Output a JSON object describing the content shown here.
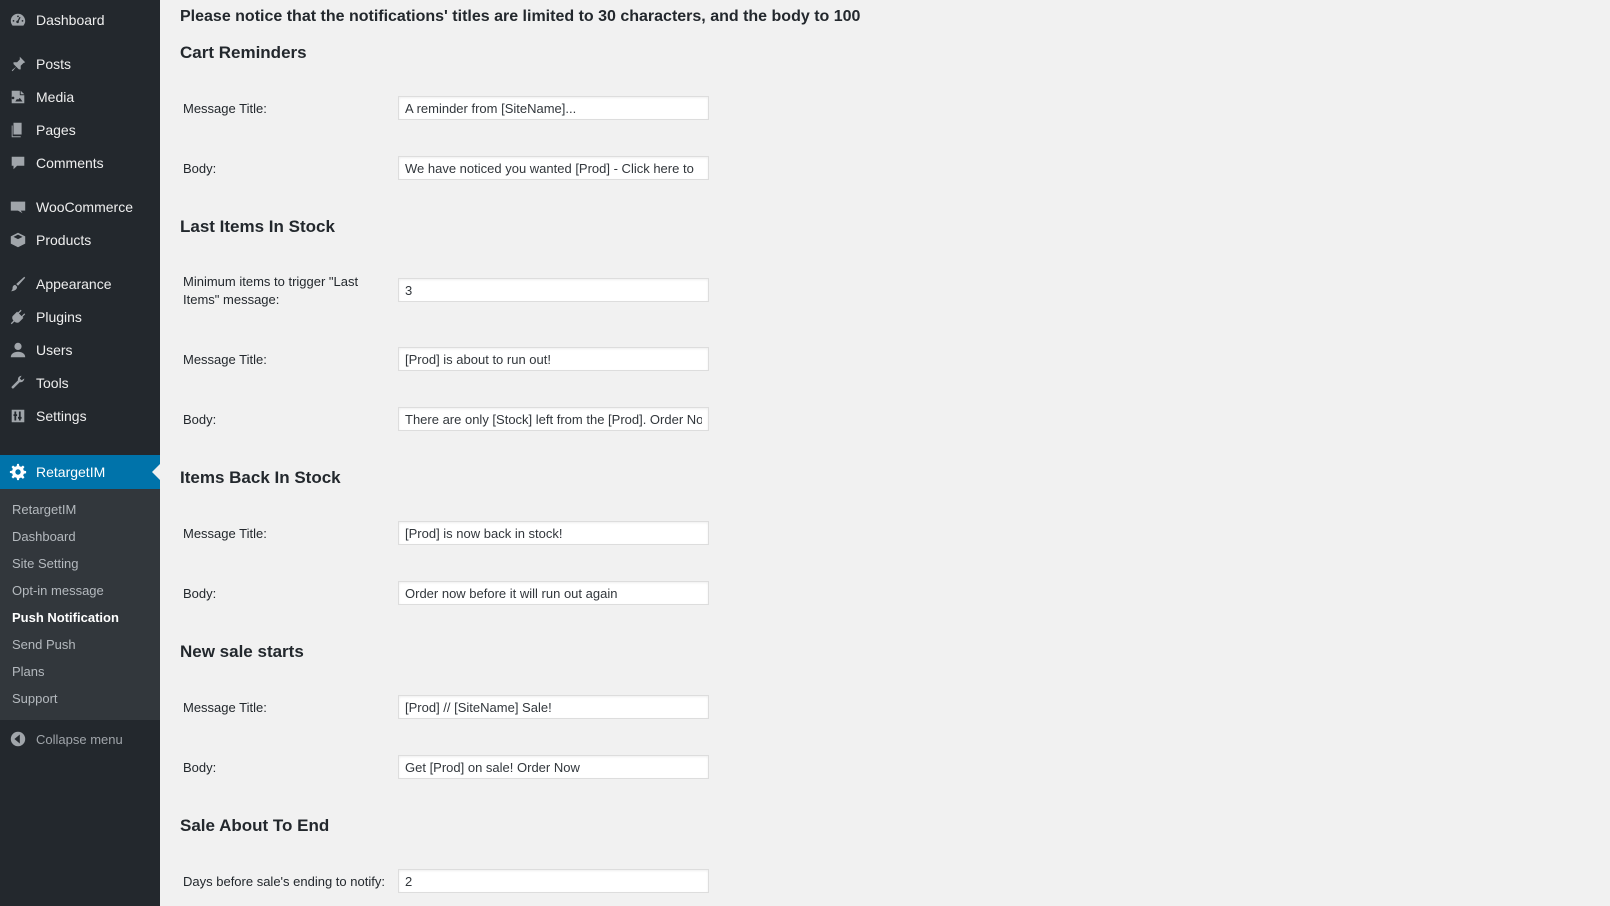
{
  "sidebar": {
    "items": [
      {
        "label": "Dashboard",
        "icon": "dashboard-icon"
      },
      {
        "label": "Posts",
        "icon": "pin-icon"
      },
      {
        "label": "Media",
        "icon": "media-icon"
      },
      {
        "label": "Pages",
        "icon": "pages-icon"
      },
      {
        "label": "Comments",
        "icon": "comment-icon"
      },
      {
        "label": "WooCommerce",
        "icon": "woocommerce-icon"
      },
      {
        "label": "Products",
        "icon": "box-icon"
      },
      {
        "label": "Appearance",
        "icon": "brush-icon"
      },
      {
        "label": "Plugins",
        "icon": "plug-icon"
      },
      {
        "label": "Users",
        "icon": "user-icon"
      },
      {
        "label": "Tools",
        "icon": "wrench-icon"
      },
      {
        "label": "Settings",
        "icon": "sliders-icon"
      },
      {
        "label": "RetargetIM",
        "icon": "gear-icon"
      }
    ],
    "submenu": [
      "RetargetIM",
      "Dashboard",
      "Site Setting",
      "Opt-in message",
      "Push Notification",
      "Send Push",
      "Plans",
      "Support"
    ],
    "collapse_label": "Collapse menu",
    "active_color": "#0073aa"
  },
  "main": {
    "notice": "Please notice that the notifications' titles are limited to 30 characters, and the body to 100",
    "sections": [
      {
        "title": "Cart Reminders",
        "fields": [
          {
            "label": "Message Title:",
            "value": "A reminder from [SiteName]..."
          },
          {
            "label": "Body:",
            "value": "We have noticed you wanted [Prod] - Click here to"
          }
        ]
      },
      {
        "title": "Last Items In Stock",
        "fields": [
          {
            "label": "Minimum items to trigger \"Last Items\" message:",
            "value": "3"
          },
          {
            "label": "Message Title:",
            "value": "[Prod] is about to run out!"
          },
          {
            "label": "Body:",
            "value": "There are only [Stock] left from the [Prod]. Order Now"
          }
        ]
      },
      {
        "title": "Items Back In Stock",
        "fields": [
          {
            "label": "Message Title:",
            "value": "[Prod] is now back in stock!"
          },
          {
            "label": "Body:",
            "value": "Order now before it will run out again"
          }
        ]
      },
      {
        "title": "New sale starts",
        "fields": [
          {
            "label": "Message Title:",
            "value": "[Prod] // [SiteName] Sale!"
          },
          {
            "label": "Body:",
            "value": "Get [Prod] on sale! Order Now"
          }
        ]
      },
      {
        "title": "Sale About To End",
        "fields": [
          {
            "label": "Days before sale's ending to notify:",
            "value": "2"
          }
        ]
      }
    ]
  }
}
